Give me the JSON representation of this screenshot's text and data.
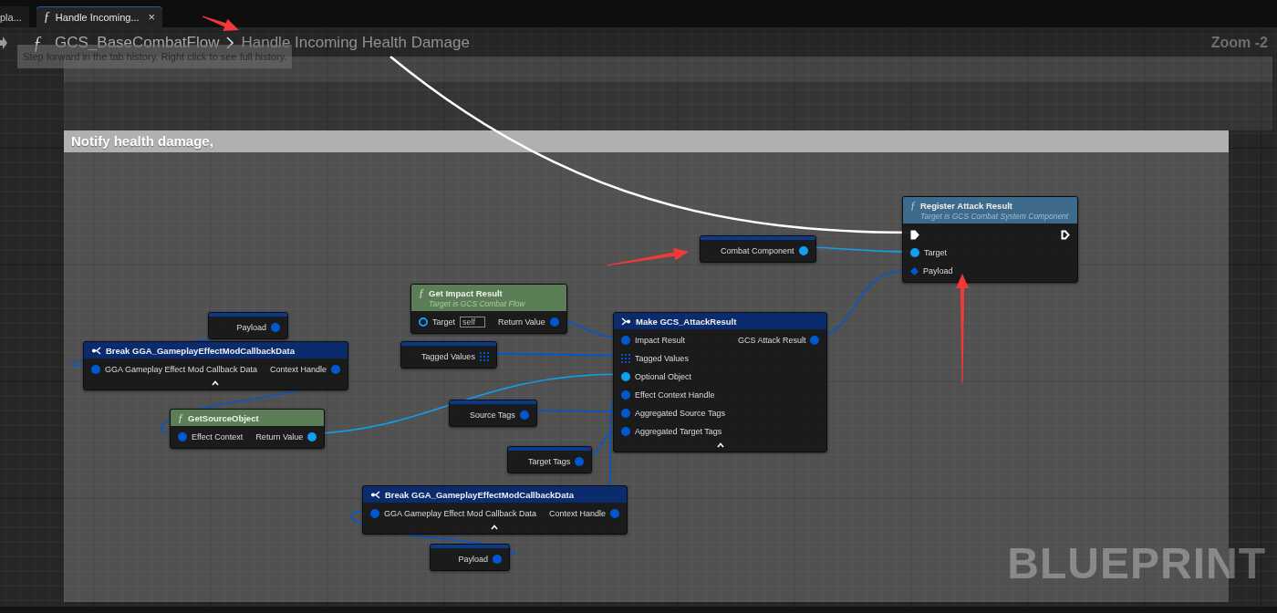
{
  "tabs": [
    {
      "label": "pla...",
      "selected": false
    },
    {
      "icon": "ƒ",
      "label": "Handle Incoming...",
      "close": "×",
      "selected": true
    }
  ],
  "breadcrumb": {
    "icon": "ƒ",
    "items": [
      "GCS_BaseCombatFlow",
      "Handle Incoming Health Damage"
    ]
  },
  "zoom": "Zoom -2",
  "tooltip": "Step forward in the tab history. Right click to see full history.",
  "comment": {
    "title": "Notify health damage,"
  },
  "nodes": [
    {
      "kind": "variable",
      "outputs": [
        {
          "label": "Payload",
          "kind": "data",
          "color": "#0058d0",
          "connected": true
        }
      ]
    },
    {
      "kind": "break_struct",
      "title": "Break GGA_GameplayEffectModCallbackData",
      "inputs": [
        {
          "label": "GGA Gameplay Effect Mod Callback Data",
          "kind": "data",
          "color": "#0058d0",
          "connected": true
        }
      ],
      "outputs": [
        {
          "label": "Context Handle",
          "kind": "data",
          "color": "#0058d0",
          "connected": true
        }
      ]
    },
    {
      "kind": "pure_function",
      "icon": "ƒ",
      "title": "GetSourceObject",
      "inputs": [
        {
          "label": "Effect Context",
          "kind": "data",
          "color": "#0058d0",
          "connected": true
        }
      ],
      "outputs": [
        {
          "label": "Return Value",
          "kind": "data",
          "color": "#10a0f0",
          "connected": true
        }
      ]
    },
    {
      "kind": "pure_function",
      "icon": "ƒ",
      "title": "Get Impact Result",
      "subtitle": "Target is GCS Combat Flow",
      "inputs": [
        {
          "label": "Target",
          "kind": "data",
          "color": "#10a0f0",
          "connected": false,
          "value": "self"
        }
      ],
      "outputs": [
        {
          "label": "Return Value",
          "kind": "data",
          "color": "#0058d0",
          "connected": true
        }
      ]
    },
    {
      "kind": "variable",
      "outputs": [
        {
          "label": "Tagged Values",
          "kind": "array",
          "color": "#0058d0",
          "connected": true
        }
      ]
    },
    {
      "kind": "variable",
      "outputs": [
        {
          "label": "Source Tags",
          "kind": "data",
          "color": "#0058d0",
          "connected": true
        }
      ]
    },
    {
      "kind": "make_struct",
      "title": "Make GCS_AttackResult",
      "inputs": [
        {
          "label": "Impact Result",
          "kind": "data",
          "color": "#0058d0",
          "connected": true
        },
        {
          "label": "Tagged Values",
          "kind": "array",
          "color": "#0058d0",
          "connected": true
        },
        {
          "label": "Optional Object",
          "kind": "data",
          "color": "#10a0f0",
          "connected": true
        },
        {
          "label": "Effect Context Handle",
          "kind": "data",
          "color": "#0058d0",
          "connected": true
        },
        {
          "label": "Aggregated Source Tags",
          "kind": "data",
          "color": "#0058d0",
          "connected": true
        },
        {
          "label": "Aggregated Target Tags",
          "kind": "data",
          "color": "#0058d0",
          "connected": true
        }
      ],
      "outputs": [
        {
          "label": "GCS Attack Result",
          "kind": "data",
          "color": "#0058d0",
          "connected": true
        }
      ]
    },
    {
      "kind": "variable",
      "outputs": [
        {
          "label": "Target Tags",
          "kind": "data",
          "color": "#0058d0",
          "connected": true
        }
      ]
    },
    {
      "kind": "break_struct",
      "title": "Break GGA_GameplayEffectModCallbackData",
      "inputs": [
        {
          "label": "GGA Gameplay Effect Mod Callback Data",
          "kind": "data",
          "color": "#0058d0",
          "connected": true
        }
      ],
      "outputs": [
        {
          "label": "Context Handle",
          "kind": "data",
          "color": "#0058d0",
          "connected": true
        }
      ]
    },
    {
      "kind": "variable",
      "outputs": [
        {
          "label": "Payload",
          "kind": "data",
          "color": "#0058d0",
          "connected": true
        }
      ]
    },
    {
      "kind": "variable",
      "outputs": [
        {
          "label": "Combat Component",
          "kind": "data",
          "color": "#10a0f0",
          "connected": true
        }
      ]
    },
    {
      "kind": "function",
      "icon": "ƒ",
      "title": "Register Attack Result",
      "subtitle": "Target is GCS Combat System Component",
      "inputs": [
        {
          "kind": "exec",
          "color": "#ffffff",
          "connected": true
        },
        {
          "label": "Target",
          "kind": "data",
          "color": "#10a0f0",
          "connected": true
        },
        {
          "label": "Payload",
          "kind": "ref",
          "color": "#0058d0",
          "connected": true
        }
      ],
      "outputs": [
        {
          "kind": "exec",
          "color": "#ffffff",
          "connected": false
        }
      ]
    }
  ],
  "watermark": "BLUEPRINT"
}
